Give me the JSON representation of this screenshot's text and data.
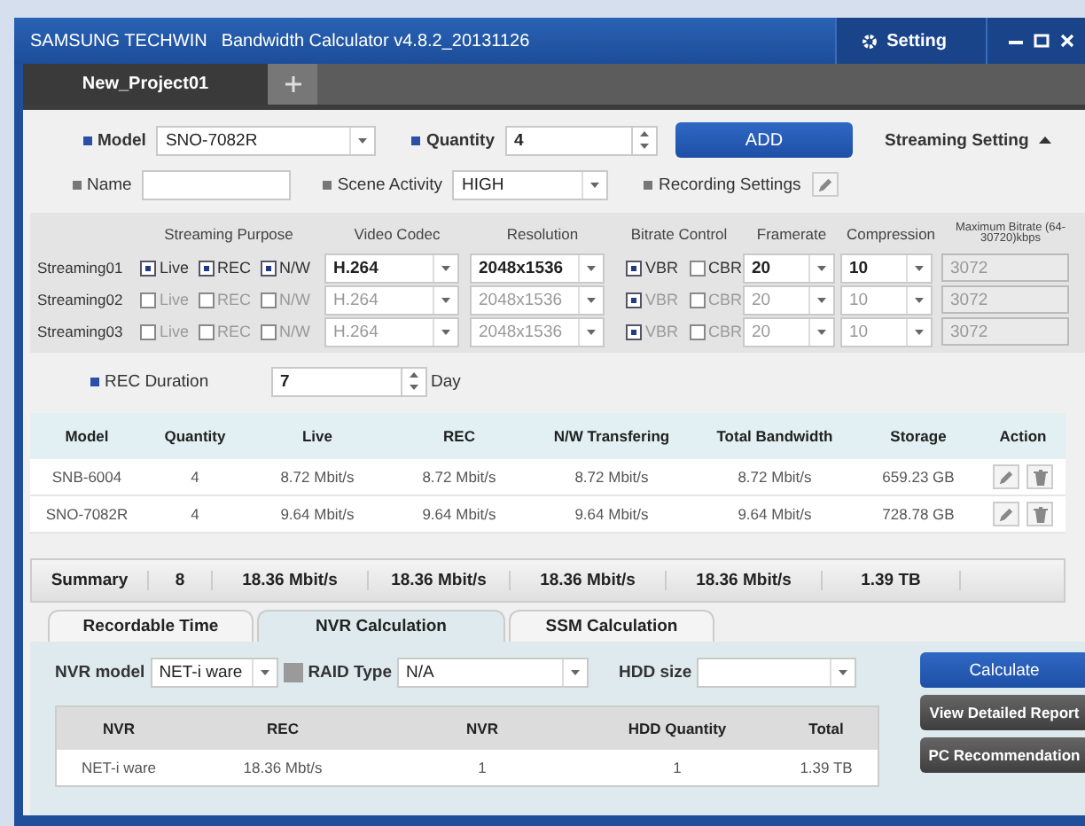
{
  "window": {
    "brand": "SAMSUNG TECHWIN",
    "title": "Bandwidth Calculator v4.8.2_20131126",
    "setting": "Setting"
  },
  "project_tabs": [
    {
      "label": "New_Project01",
      "selected": true
    }
  ],
  "model": {
    "label": "Model",
    "value": "SNO-7082R"
  },
  "quantity": {
    "label": "Quantity",
    "value": "4"
  },
  "add_button": "ADD",
  "streaming_setting": {
    "label": "Streaming Setting",
    "expanded": true
  },
  "name": {
    "label": "Name"
  },
  "scene_activity": {
    "label": "Scene Activity",
    "value": "HIGH"
  },
  "recording_settings": {
    "label": "Recording Settings"
  },
  "stream_columns": [
    "Streaming Purpose",
    "Video Codec",
    "Resolution",
    "Bitrate Control",
    "Framerate",
    "Compression",
    "Maximum Bitrate (64-30720)kbps"
  ],
  "streams": [
    {
      "name": "Streaming01",
      "disabled": false,
      "purposes": [
        {
          "label": "Live",
          "checked": true
        },
        {
          "label": "REC",
          "checked": true
        },
        {
          "label": "N/W",
          "checked": true
        }
      ],
      "codec": "H.264",
      "resolution": "2048x1536",
      "bitrate": [
        {
          "label": "VBR",
          "checked": true
        },
        {
          "label": "CBR",
          "checked": false
        }
      ],
      "framerate": "20",
      "compression": "10",
      "max_bitrate": "3072"
    },
    {
      "name": "Streaming02",
      "disabled": true,
      "purposes": [
        {
          "label": "Live",
          "checked": false
        },
        {
          "label": "REC",
          "checked": false
        },
        {
          "label": "N/W",
          "checked": false
        }
      ],
      "codec": "H.264",
      "resolution": "2048x1536",
      "bitrate": [
        {
          "label": "VBR",
          "checked": true
        },
        {
          "label": "CBR",
          "checked": false
        }
      ],
      "framerate": "20",
      "compression": "10",
      "max_bitrate": "3072"
    },
    {
      "name": "Streaming03",
      "disabled": true,
      "purposes": [
        {
          "label": "Live",
          "checked": false
        },
        {
          "label": "REC",
          "checked": false
        },
        {
          "label": "N/W",
          "checked": false
        }
      ],
      "codec": "H.264",
      "resolution": "2048x1536",
      "bitrate": [
        {
          "label": "VBR",
          "checked": true
        },
        {
          "label": "CBR",
          "checked": false
        }
      ],
      "framerate": "20",
      "compression": "10",
      "max_bitrate": "3072"
    }
  ],
  "rec_duration": {
    "label": "REC Duration",
    "value": "7",
    "unit": "Day"
  },
  "models_table": {
    "columns": [
      "Model",
      "Quantity",
      "Live",
      "REC",
      "N/W Transfering",
      "Total Bandwidth",
      "Storage",
      "Action"
    ],
    "rows": [
      {
        "cells": [
          "SNB-6004",
          "4",
          "8.72 Mbit/s",
          "8.72 Mbit/s",
          "8.72 Mbit/s",
          "8.72 Mbit/s",
          "659.23 GB"
        ]
      },
      {
        "cells": [
          "SNO-7082R",
          "4",
          "9.64 Mbit/s",
          "9.64 Mbit/s",
          "9.64 Mbit/s",
          "9.64 Mbit/s",
          "728.78 GB"
        ]
      }
    ]
  },
  "summary": [
    "Summary",
    "8",
    "18.36 Mbit/s",
    "18.36 Mbit/s",
    "18.36 Mbit/s",
    "18.36 Mbit/s",
    "1.39 TB"
  ],
  "calc_tabs": [
    {
      "label": "Recordable Time",
      "selected": false
    },
    {
      "label": "NVR Calculation",
      "selected": true
    },
    {
      "label": "SSM Calculation",
      "selected": false
    }
  ],
  "nvr_model": {
    "label": "NVR model",
    "value": "NET-i ware"
  },
  "raid_type": {
    "label": "RAID Type",
    "value": "N/A"
  },
  "hdd_size": {
    "label": "HDD size"
  },
  "buttons": [
    {
      "label": "Calculate",
      "kind": "primary"
    },
    {
      "label": "View Detailed Report",
      "kind": "dark"
    },
    {
      "label": "PC Recommendation",
      "kind": "dark"
    }
  ],
  "nvr_table": {
    "columns": [
      "NVR",
      "REC",
      "NVR",
      "HDD Quantity",
      "Total"
    ],
    "rows": [
      [
        "NET-i ware",
        "18.36 Mbt/s",
        "1",
        "1",
        "1.39 TB"
      ]
    ]
  }
}
